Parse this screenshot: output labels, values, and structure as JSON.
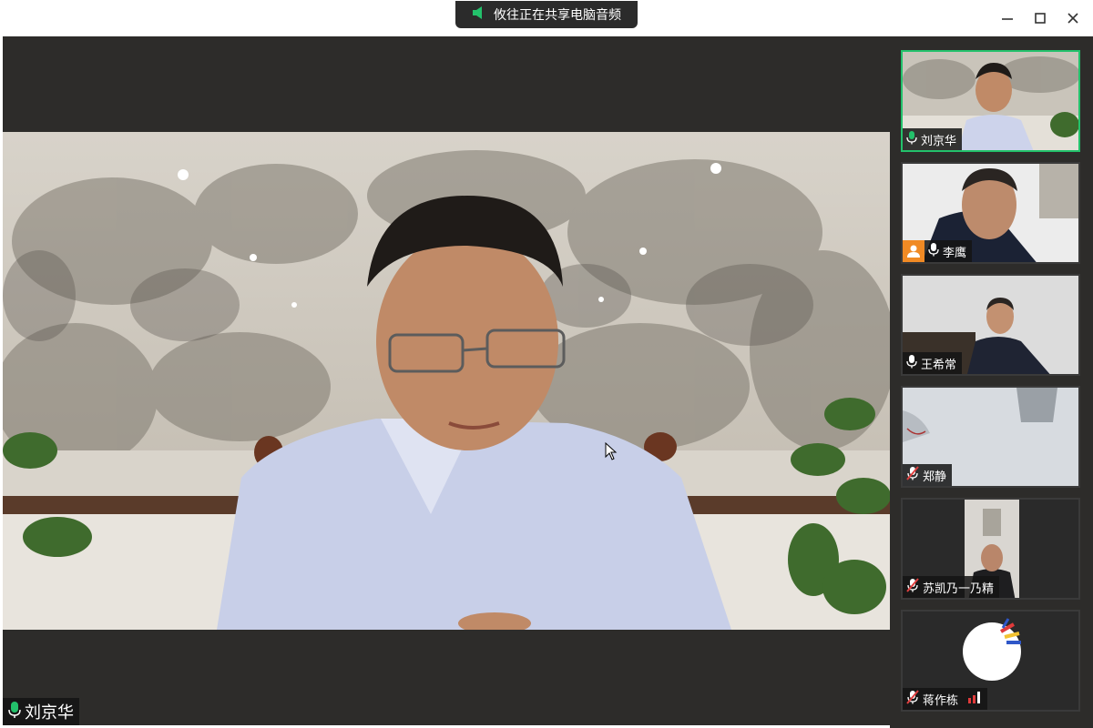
{
  "share_banner": {
    "text": "攸往正在共享电脑音频"
  },
  "main_video": {
    "speaker_name": "刘京华"
  },
  "participants": [
    {
      "name": "刘京华",
      "mic": "on"
    },
    {
      "name": "李鹰",
      "mic": "on"
    },
    {
      "name": "王希常",
      "mic": "on"
    },
    {
      "name": "郑静",
      "mic": "muted"
    },
    {
      "name": "苏凯乃一乃精",
      "mic": "muted"
    },
    {
      "name": "蒋作栋",
      "mic": "muted"
    }
  ],
  "colors": {
    "accent_green": "#23c16b",
    "muted_red": "#e04040",
    "signal_red": "#e03a3a",
    "avatar_orange": "#f08a24"
  }
}
